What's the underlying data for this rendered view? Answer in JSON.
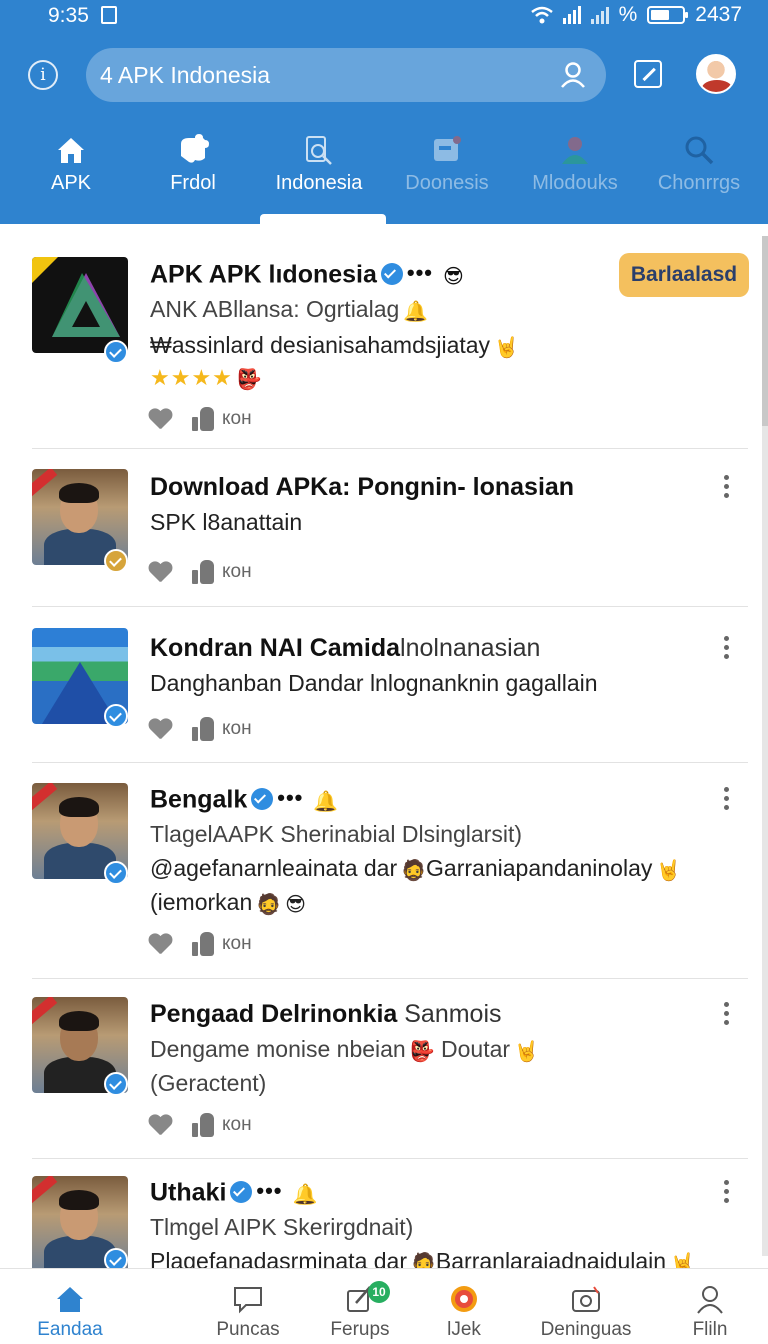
{
  "status_bar": {
    "time": "9:35",
    "battery": "2437"
  },
  "search": {
    "placeholder": "4 APK Indonesia"
  },
  "tabs": [
    {
      "label": "APK",
      "icon": "home-icon",
      "active": false
    },
    {
      "label": "Frdol",
      "icon": "puzzle-icon",
      "active": false
    },
    {
      "label": "Indonesia",
      "icon": "document-search-icon",
      "active": true
    },
    {
      "label": "Doonesis",
      "icon": "media-icon",
      "active": false
    },
    {
      "label": "Mlodouks",
      "icon": "person-icon",
      "active": false
    },
    {
      "label": "Chonrrgs",
      "icon": "search-icon",
      "active": false
    }
  ],
  "posts": [
    {
      "title": "APK APK lıdonesia",
      "line1": "ANK ABllansa: Ogrtialag",
      "line2": "₩assinlard desianisahamdsjiatay",
      "stars": "★★★★",
      "action_label": "кон",
      "button": "Barlaalasd"
    },
    {
      "title": "Download APKa: Pongnin- lonasian",
      "line1": "SPK l8anattain",
      "action_label": "кон"
    },
    {
      "title_bold": "Kondran NAI Camida",
      "title_light": "lnolnanasian",
      "line1": "Danghanban Dandar lnlognanknin gagallain",
      "action_label": "кон"
    },
    {
      "title": "Bengalk",
      "line1": "TlagelAAPK Sherinabial Dlsinglarsit)",
      "line2": "@agefanarnleainata dar",
      "line2b": "Garraniapandaninolay",
      "line3": "(iemorkan",
      "action_label": "кон"
    },
    {
      "title_bold": "Pengaad Delrinonkia",
      "title_light": "Sanmois",
      "line1": "Dengame monise nbeian",
      "line1b": "Doutar",
      "line2": "(Geractent)",
      "action_label": "кон"
    },
    {
      "title": "Uthaki",
      "line1": "Tlmgel AIPK Skerirgdnait)",
      "line2": "Plagefanadasrminata dar",
      "line2b": "Barranlaraiadnaidulain"
    }
  ],
  "bottom_nav": [
    {
      "label": "Eandaa",
      "icon": "home-icon",
      "active": true
    },
    {
      "label": "Puncas",
      "icon": "chat-icon",
      "active": false
    },
    {
      "label": "Ferups",
      "icon": "edit-icon",
      "badge": "10",
      "active": false
    },
    {
      "label": "lJek",
      "icon": "target-icon",
      "active": false
    },
    {
      "label": "Deninguas",
      "icon": "camera-icon",
      "active": false
    },
    {
      "label": "Fliln",
      "icon": "profile-icon",
      "active": false
    }
  ],
  "colors": {
    "header": "#2f83cf",
    "accent_button": "#f4c05e",
    "verified": "#2f8de0"
  }
}
